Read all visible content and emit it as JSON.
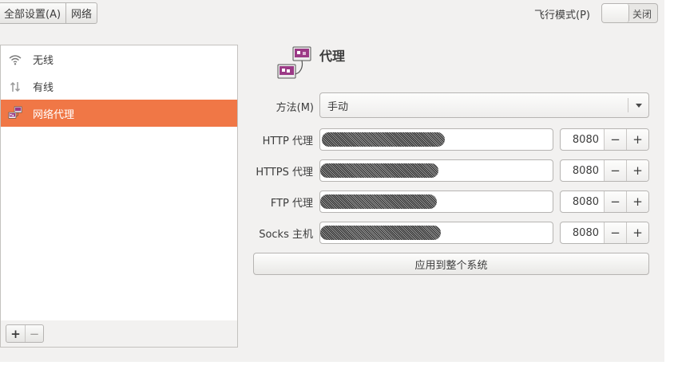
{
  "breadcrumb": {
    "all_settings": "全部设置(A)",
    "current": "网络"
  },
  "airplane": {
    "label": "飞行模式(P)",
    "state_text": "关闭"
  },
  "sidebar": {
    "items": [
      {
        "label": "无线",
        "icon": "wifi-icon"
      },
      {
        "label": "有线",
        "icon": "wired-icon"
      },
      {
        "label": "网络代理",
        "icon": "proxy-icon",
        "active": true
      }
    ],
    "add_label": "+",
    "remove_label": "−"
  },
  "main": {
    "title": "代理",
    "method": {
      "label": "方法(M)",
      "value": "手动"
    },
    "rows": [
      {
        "label": "HTTP 代理",
        "port": "8080"
      },
      {
        "label": "HTTPS 代理",
        "port": "8080"
      },
      {
        "label": "FTP 代理",
        "port": "8080"
      },
      {
        "label": "Socks 主机",
        "port": "8080"
      }
    ],
    "minus_label": "−",
    "plus_label": "+",
    "apply_label": "应用到整个系统"
  },
  "colors": {
    "accent": "#f07746",
    "window_bg": "#f2f1f0"
  }
}
